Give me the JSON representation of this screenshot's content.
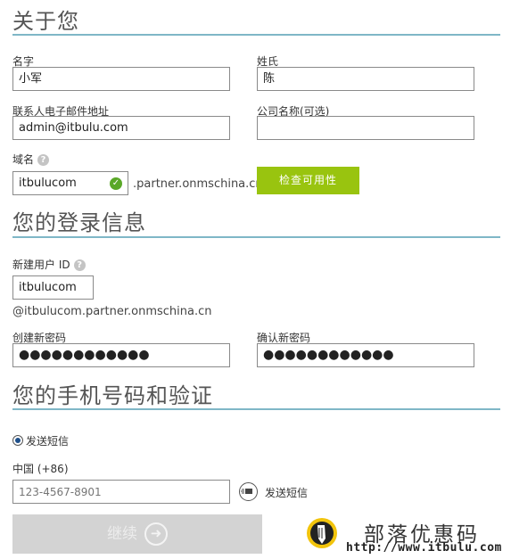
{
  "about": {
    "title": "关于您",
    "first_name": {
      "label": "名字",
      "value": "小军"
    },
    "last_name": {
      "label": "姓氏",
      "value": "陈"
    },
    "email": {
      "label": "联系人电子邮件地址",
      "value": "admin@itbulu.com"
    },
    "company": {
      "label": "公司名称(可选)",
      "value": ""
    },
    "domain": {
      "label": "域名",
      "help": "?",
      "value": "itbulucom",
      "suffix": ".partner.onmschina.cn",
      "check_button": "检查可用性"
    }
  },
  "login": {
    "title": "您的登录信息",
    "user_id": {
      "label": "新建用户 ID",
      "help": "?",
      "value": "itbulucom",
      "suffix": "@itbulucom.partner.onmschina.cn"
    },
    "password": {
      "label": "创建新密码",
      "value": "●●●●●●●●●●●●"
    },
    "confirm_password": {
      "label": "确认新密码",
      "value": "●●●●●●●●●●●●"
    }
  },
  "phone": {
    "title": "您的手机号码和验证",
    "radio_label": "发送短信",
    "country": "中国 (+86)",
    "phone_placeholder": "123-4567-8901",
    "send_sms": "发送短信"
  },
  "continue_button": "继续",
  "continue_icon": "arrow-right-circle-icon",
  "watermark": {
    "title": "部落优惠码",
    "url": "http://www.itbulu.com",
    "logo_icon": "pencil-logo-icon"
  },
  "colors": {
    "rule": "#7fb7c7",
    "green_button": "#99c40f",
    "check": "#5aa828",
    "disabled_button": "#d3d3d3"
  }
}
